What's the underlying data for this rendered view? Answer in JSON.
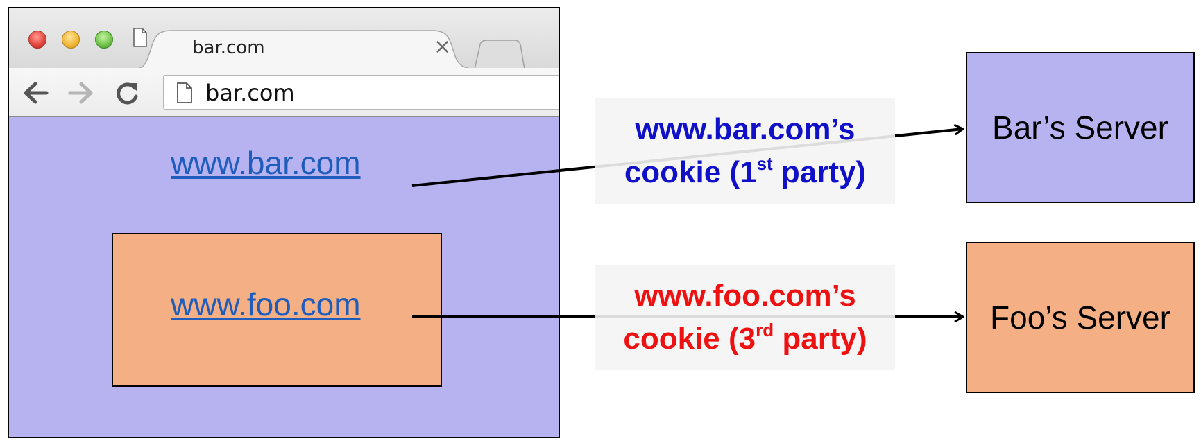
{
  "browser": {
    "tab_title": "bar.com",
    "tab_close": "×",
    "address": "bar.com"
  },
  "page": {
    "main_link": "www.bar.com",
    "iframe_link": "www.foo.com"
  },
  "cookies": {
    "first": {
      "line1": "www.bar.com’s",
      "line2_pre": "cookie (1",
      "line2_sup": "st",
      "line2_post": " party)"
    },
    "third": {
      "line1": "www.foo.com’s",
      "line2_pre": "cookie (3",
      "line2_sup": "rd",
      "line2_post": " party)"
    }
  },
  "servers": {
    "bar": "Bar’s Server",
    "foo": "Foo’s Server"
  },
  "colors": {
    "browser_content": "#b7b3f0",
    "iframe": "#f4b084",
    "first_party_text": "#1010c8",
    "third_party_text": "#ee1111",
    "link": "#1f5dbc"
  }
}
